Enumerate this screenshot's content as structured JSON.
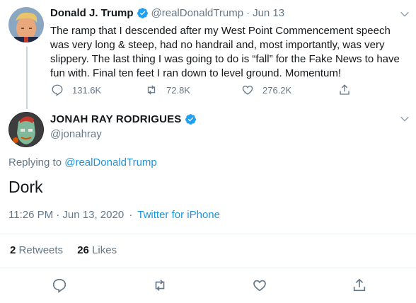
{
  "parent_tweet": {
    "display_name": "Donald J. Trump",
    "handle": "@realDonaldTrump",
    "date": "Jun 13",
    "text_lines": [
      "The ramp that I descended after my West Point Commencement speech",
      "was very long & steep, had no handrail and, most importantly, was very",
      "slippery. The last thing I was going to do is “fall” for the Fake News to have",
      "fun with. Final ten feet I ran down to level ground. Momentum!"
    ],
    "replies": "131.6K",
    "retweets": "72.8K",
    "likes": "276.2K"
  },
  "main_tweet": {
    "display_name": "JONAH RAY RODRIGUES",
    "handle": "@jonahray",
    "replying_to_prefix": "Replying to ",
    "replying_to_handle": "@realDonaldTrump",
    "text": "Dork",
    "timestamp": "11:26 PM · Jun 13, 2020",
    "separator": "·",
    "source": "Twitter for iPhone",
    "retweet_count": "2",
    "retweet_label": "Retweets",
    "like_count": "26",
    "like_label": "Likes"
  },
  "colors": {
    "accent": "#1da1f2",
    "link": "#1b95e0",
    "muted": "#657786",
    "divider": "#e6ecf0"
  }
}
